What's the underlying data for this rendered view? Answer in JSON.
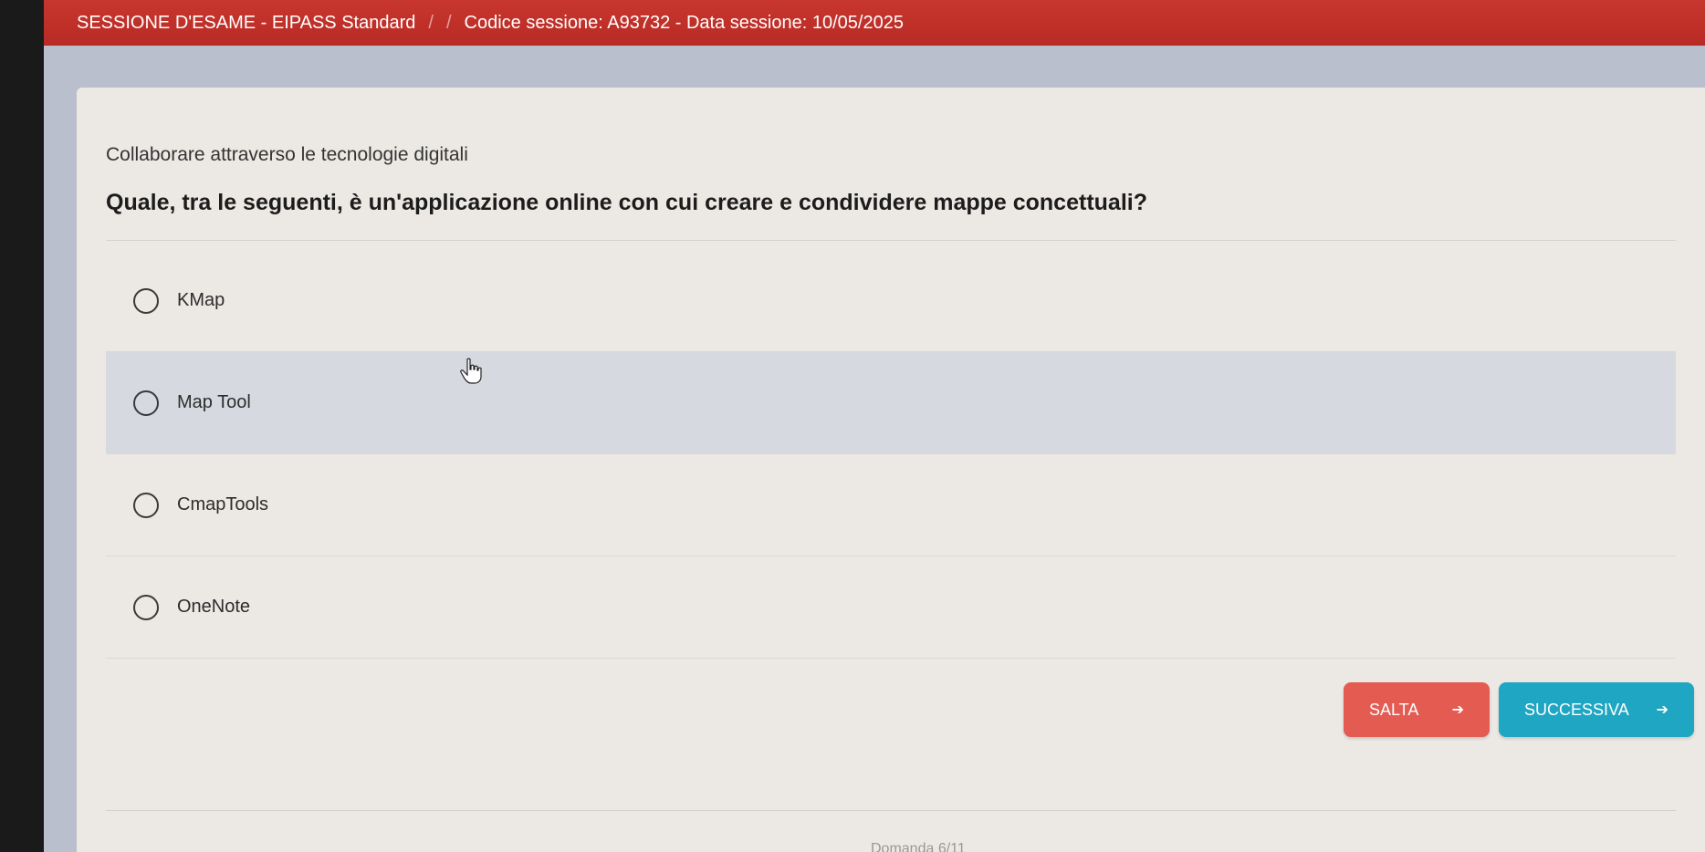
{
  "header": {
    "session_title": "SESSIONE D'ESAME - EIPASS Standard",
    "separator_1": "/",
    "separator_2": "/",
    "session_info": "Codice sessione: A93732 - Data sessione: 10/05/2025"
  },
  "question": {
    "category": "Collaborare attraverso le tecnologie digitali",
    "text": "Quale, tra le seguenti, è un'applicazione online con cui creare e condividere mappe concettuali?"
  },
  "answers": [
    {
      "label": "KMap"
    },
    {
      "label": "Map Tool"
    },
    {
      "label": "CmapTools"
    },
    {
      "label": "OneNote"
    }
  ],
  "buttons": {
    "skip_label": "SALTA",
    "next_label": "SUCCESSIVA"
  },
  "footer": {
    "page_indicator": "Domanda 6/11"
  },
  "colors": {
    "header_bg": "#c7372f",
    "skip_button": "#e45b52",
    "next_button": "#1fa6c2",
    "hover_row": "#d6dae0"
  },
  "icons": {
    "arrow": "arrow-right-icon",
    "cursor": "hand-pointer-icon"
  }
}
